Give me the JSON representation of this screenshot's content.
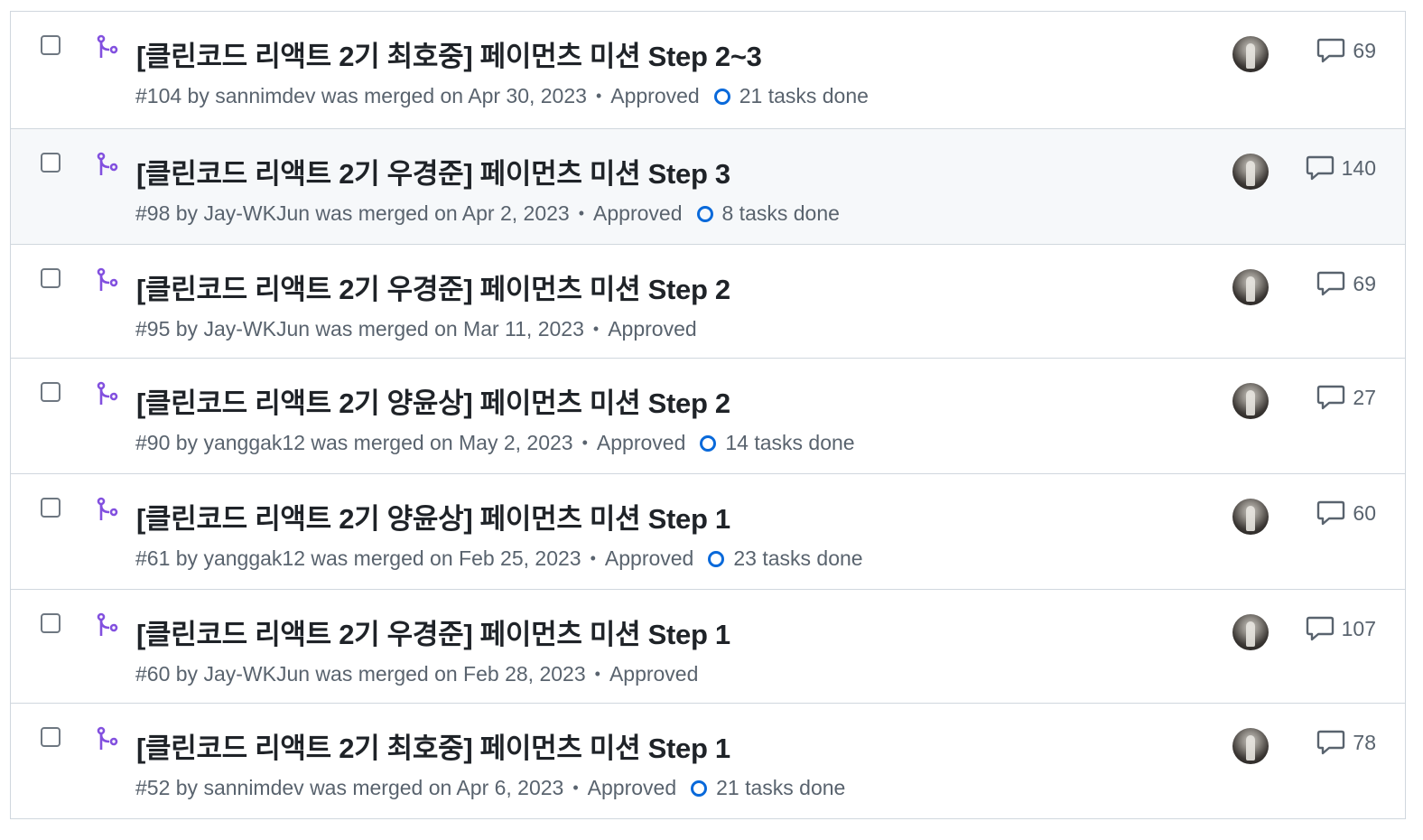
{
  "pull_requests": [
    {
      "title": "[클린코드 리액트 2기 최호중] 페이먼츠 미션 Step 2~3",
      "meta": "#104 by sannimdev was merged on Apr 30, 2023",
      "review": "Approved",
      "tasks": "21 tasks done",
      "comments": "69"
    },
    {
      "title": "[클린코드 리액트 2기 우경준] 페이먼츠 미션 Step 3",
      "meta": "#98 by Jay-WKJun was merged on Apr 2, 2023",
      "review": "Approved",
      "tasks": "8 tasks done",
      "comments": "140"
    },
    {
      "title": "[클린코드 리액트 2기 우경준] 페이먼츠 미션 Step 2",
      "meta": "#95 by Jay-WKJun was merged on Mar 11, 2023",
      "review": "Approved",
      "tasks": "",
      "comments": "69"
    },
    {
      "title": "[클린코드 리액트 2기 양윤상] 페이먼츠 미션 Step 2",
      "meta": "#90 by yanggak12 was merged on May 2, 2023",
      "review": "Approved",
      "tasks": "14 tasks done",
      "comments": "27"
    },
    {
      "title": "[클린코드 리액트 2기 양윤상] 페이먼츠 미션 Step 1",
      "meta": "#61 by yanggak12 was merged on Feb 25, 2023",
      "review": "Approved",
      "tasks": "23 tasks done",
      "comments": "60"
    },
    {
      "title": "[클린코드 리액트 2기 우경준] 페이먼츠 미션 Step 1",
      "meta": "#60 by Jay-WKJun was merged on Feb 28, 2023",
      "review": "Approved",
      "tasks": "",
      "comments": "107"
    },
    {
      "title": "[클린코드 리액트 2기 최호중] 페이먼츠 미션 Step 1",
      "meta": "#52 by sannimdev was merged on Apr 6, 2023",
      "review": "Approved",
      "tasks": "21 tasks done",
      "comments": "78"
    }
  ],
  "colors": {
    "merged_icon": "#8250df",
    "task_ring": "#0969da",
    "border": "#d0d7de",
    "muted_text": "#59636e"
  }
}
